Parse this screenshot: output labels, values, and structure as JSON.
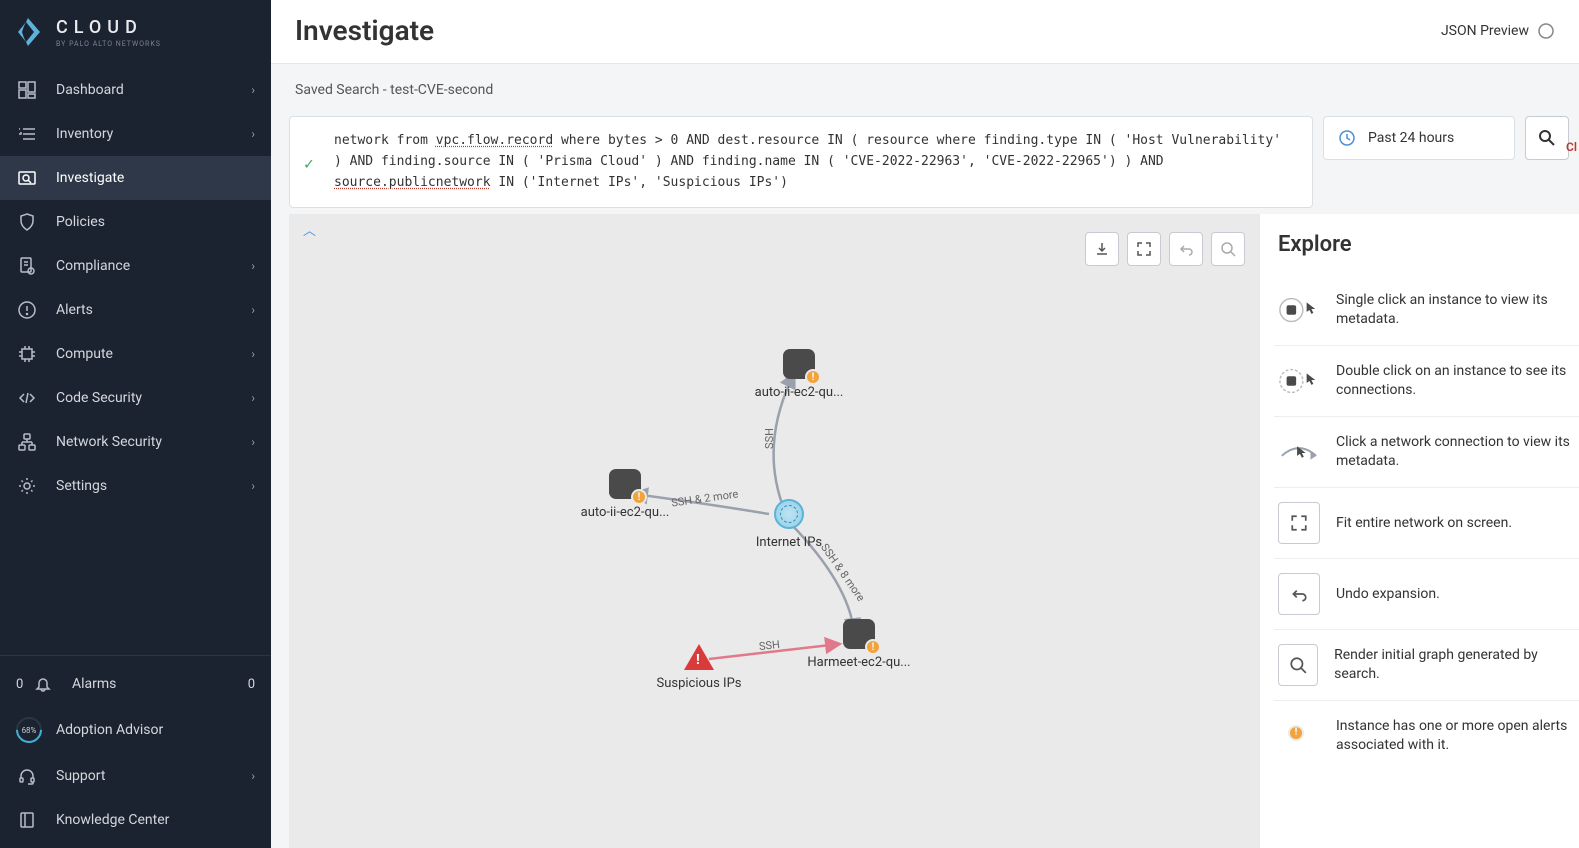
{
  "brand": {
    "name": "CLOUD",
    "tagline": "BY PALO ALTO NETWORKS"
  },
  "nav": {
    "items": [
      {
        "label": "Dashboard",
        "chevron": true
      },
      {
        "label": "Inventory",
        "chevron": true
      },
      {
        "label": "Investigate",
        "chevron": false,
        "active": true
      },
      {
        "label": "Policies",
        "chevron": false
      },
      {
        "label": "Compliance",
        "chevron": true
      },
      {
        "label": "Alerts",
        "chevron": true
      },
      {
        "label": "Compute",
        "chevron": true
      },
      {
        "label": "Code Security",
        "chevron": true
      },
      {
        "label": "Network Security",
        "chevron": true
      },
      {
        "label": "Settings",
        "chevron": true
      }
    ]
  },
  "sidebarBottom": {
    "alarmsLeft": "0",
    "alarmsLabel": "Alarms",
    "alarmsRight": "0",
    "gauge": "68%",
    "adoption": "Adoption Advisor",
    "support": "Support",
    "knowledge": "Knowledge Center"
  },
  "header": {
    "title": "Investigate",
    "jsonPreview": "JSON Preview"
  },
  "savedSearch": "Saved Search - test-CVE-second",
  "clBadge": "Cl",
  "query": {
    "pre": "network from ",
    "u1": "vpc.flow.record",
    "mid1": " where bytes > 0 AND dest.resource IN ( resource where finding.type IN ( 'Host Vulnerability' ) AND finding.source IN ( 'Prisma Cloud' ) AND finding.name IN ( 'CVE-2022-22963', 'CVE-2022-22965') ) AND ",
    "u2": "source.publicnetwork",
    "post": " IN ('Internet IPs', 'Suspicious IPs')"
  },
  "timeRange": "Past 24 hours",
  "explore": {
    "title": "Explore",
    "tips": [
      "Single click an instance to view its metadata.",
      "Double click on an instance to see its connections.",
      "Click a network connection to view its metadata.",
      "Fit entire network on screen.",
      "Undo expansion.",
      "Render initial graph generated by search.",
      "Instance has one or more open alerts associated with it."
    ]
  },
  "graph": {
    "nodes": {
      "n1": "auto-ii-ec2-qu...",
      "n2": "auto-ii-ec2-qu...",
      "n3": "Harmeet-ec2-qu...",
      "internet": "Internet IPs",
      "susp": "Suspicious IPs"
    },
    "edges": {
      "e1": "SSH",
      "e2": "SSH & 2 more",
      "e3": "SSH & 8 more",
      "e4": "SSH"
    }
  }
}
